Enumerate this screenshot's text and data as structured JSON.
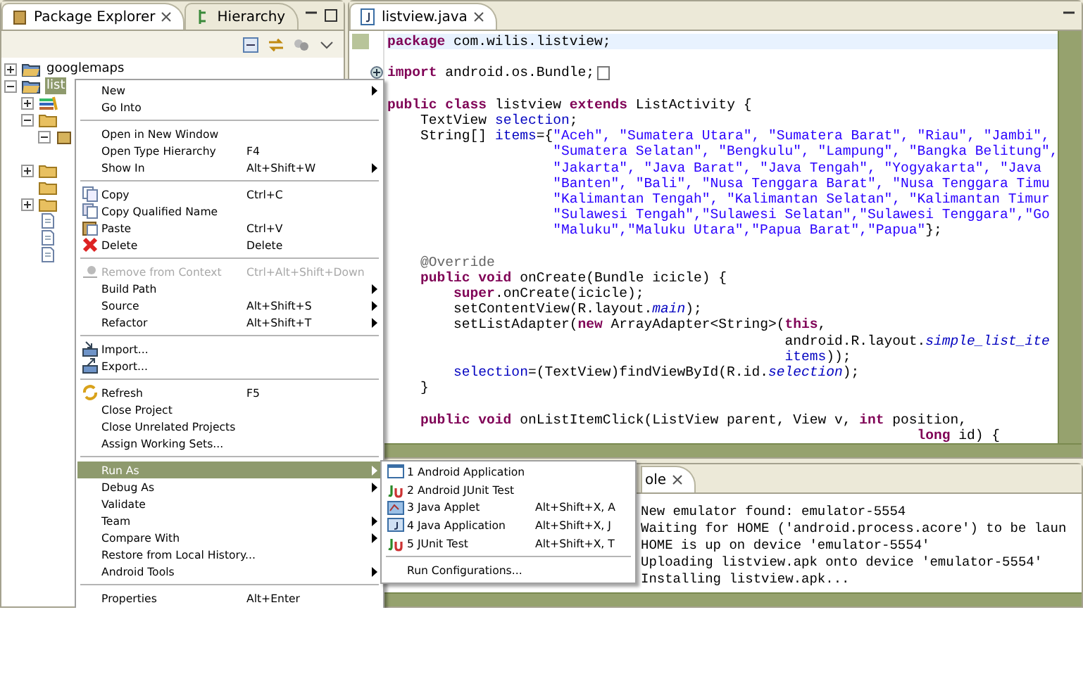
{
  "explorer": {
    "tabs": [
      {
        "label": "Package Explorer",
        "selected": true,
        "closable": true
      },
      {
        "label": "Hierarchy",
        "selected": false,
        "closable": false
      }
    ],
    "tree": [
      {
        "label": "googlemaps",
        "expanded": false,
        "selected": false
      },
      {
        "label": "list",
        "expanded": true,
        "selected": true,
        "children": [
          {
            "kind": "library",
            "expanded": false
          },
          {
            "kind": "folder",
            "expanded": true,
            "children": [
              {
                "kind": "package",
                "expanded": true
              }
            ]
          },
          {
            "kind": "blank"
          },
          {
            "kind": "folder",
            "expanded": false
          },
          {
            "kind": "folder"
          },
          {
            "kind": "folder",
            "expanded": false
          },
          {
            "kind": "file"
          },
          {
            "kind": "file"
          },
          {
            "kind": "file"
          }
        ]
      }
    ]
  },
  "context_menu": [
    {
      "kind": "item",
      "label": "New",
      "submenu": true,
      "selected": false,
      "disabled": false
    },
    {
      "kind": "item",
      "label": "Go Into",
      "selected": false,
      "disabled": false
    },
    {
      "kind": "separator"
    },
    {
      "kind": "item",
      "label": "Open in New Window",
      "selected": false,
      "disabled": false
    },
    {
      "kind": "item",
      "label": "Open Type Hierarchy",
      "shortcut": "F4",
      "selected": false,
      "disabled": false
    },
    {
      "kind": "item",
      "label": "Show In",
      "shortcut": "Alt+Shift+W",
      "submenu": true,
      "selected": false,
      "disabled": false
    },
    {
      "kind": "separator"
    },
    {
      "kind": "item",
      "label": "Copy",
      "shortcut": "Ctrl+C",
      "selected": false,
      "disabled": false
    },
    {
      "kind": "item",
      "label": "Copy Qualified Name",
      "selected": false,
      "disabled": false
    },
    {
      "kind": "item",
      "label": "Paste",
      "shortcut": "Ctrl+V",
      "selected": false,
      "disabled": false
    },
    {
      "kind": "item",
      "label": "Delete",
      "shortcut": "Delete",
      "selected": false,
      "disabled": false
    },
    {
      "kind": "separator"
    },
    {
      "kind": "item",
      "label": "Remove from Context",
      "shortcut": "Ctrl+Alt+Shift+Down",
      "selected": false,
      "disabled": true
    },
    {
      "kind": "item",
      "label": "Build Path",
      "submenu": true,
      "selected": false,
      "disabled": false
    },
    {
      "kind": "item",
      "label": "Source",
      "shortcut": "Alt+Shift+S",
      "submenu": true,
      "selected": false,
      "disabled": false
    },
    {
      "kind": "item",
      "label": "Refactor",
      "shortcut": "Alt+Shift+T",
      "submenu": true,
      "selected": false,
      "disabled": false
    },
    {
      "kind": "separator"
    },
    {
      "kind": "item",
      "label": "Import...",
      "selected": false,
      "disabled": false
    },
    {
      "kind": "item",
      "label": "Export...",
      "selected": false,
      "disabled": false
    },
    {
      "kind": "separator"
    },
    {
      "kind": "item",
      "label": "Refresh",
      "shortcut": "F5",
      "selected": false,
      "disabled": false
    },
    {
      "kind": "item",
      "label": "Close Project",
      "selected": false,
      "disabled": false
    },
    {
      "kind": "item",
      "label": "Close Unrelated Projects",
      "selected": false,
      "disabled": false
    },
    {
      "kind": "item",
      "label": "Assign Working Sets...",
      "selected": false,
      "disabled": false
    },
    {
      "kind": "separator"
    },
    {
      "kind": "item",
      "label": "Run As",
      "submenu": true,
      "selected": true,
      "disabled": false
    },
    {
      "kind": "item",
      "label": "Debug As",
      "submenu": true,
      "selected": false,
      "disabled": false
    },
    {
      "kind": "item",
      "label": "Validate",
      "selected": false,
      "disabled": false
    },
    {
      "kind": "item",
      "label": "Team",
      "submenu": true,
      "selected": false,
      "disabled": false
    },
    {
      "kind": "item",
      "label": "Compare With",
      "submenu": true,
      "selected": false,
      "disabled": false
    },
    {
      "kind": "item",
      "label": "Restore from Local History...",
      "selected": false,
      "disabled": false
    },
    {
      "kind": "item",
      "label": "Android Tools",
      "submenu": true,
      "selected": false,
      "disabled": false
    },
    {
      "kind": "separator"
    },
    {
      "kind": "item",
      "label": "Properties",
      "shortcut": "Alt+Enter",
      "selected": false,
      "disabled": false
    }
  ],
  "run_as_menu": [
    {
      "kind": "item",
      "label": "1 Android Application"
    },
    {
      "kind": "item",
      "label": "2 Android JUnit Test"
    },
    {
      "kind": "item",
      "label": "3 Java Applet",
      "shortcut": "Alt+Shift+X, A"
    },
    {
      "kind": "item",
      "label": "4 Java Application",
      "shortcut": "Alt+Shift+X, J"
    },
    {
      "kind": "item",
      "label": "5 JUnit Test",
      "shortcut": "Alt+Shift+X, T"
    },
    {
      "kind": "separator"
    },
    {
      "kind": "item",
      "label": "Run Configurations..."
    }
  ],
  "editor": {
    "tab": {
      "label": "listview.java",
      "selected": true
    },
    "lines": [
      {
        "current": true,
        "segments": [
          {
            "kind": "keyword",
            "text": "package"
          },
          {
            "kind": "plain",
            "text": " com.wilis.listview;"
          }
        ]
      },
      {
        "current": false
      },
      {
        "current": false,
        "folded": true,
        "segments": [
          {
            "kind": "keyword",
            "text": "import"
          },
          {
            "kind": "plain",
            "text": " android.os.Bundle;"
          }
        ]
      },
      {
        "current": false
      },
      {
        "current": false,
        "segments": [
          {
            "kind": "keyword",
            "text": "public class"
          },
          {
            "kind": "plain",
            "text": " listview "
          },
          {
            "kind": "keyword",
            "text": "extends"
          },
          {
            "kind": "plain",
            "text": " ListActivity {"
          }
        ]
      },
      {
        "current": false,
        "segments": [
          {
            "kind": "plain",
            "text": "    TextView "
          },
          {
            "kind": "field",
            "text": "selection"
          },
          {
            "kind": "plain",
            "text": ";"
          }
        ]
      },
      {
        "current": false,
        "segments": [
          {
            "kind": "plain",
            "text": "    String[] "
          },
          {
            "kind": "field",
            "text": "items"
          },
          {
            "kind": "plain",
            "text": "={"
          },
          {
            "kind": "string",
            "text": "\"Aceh\", \"Sumatera Utara\", \"Sumatera Barat\", \"Riau\", \"Jambi\","
          }
        ]
      },
      {
        "current": false,
        "segments": [
          {
            "kind": "string",
            "text": "                    \"Sumatera Selatan\", \"Bengkulu\", \"Lampung\", \"Bangka Belitung\","
          }
        ]
      },
      {
        "current": false,
        "segments": [
          {
            "kind": "string",
            "text": "                    \"Jakarta\", \"Java Barat\", \"Java Tengah\", \"Yogyakarta\", \"Java"
          }
        ]
      },
      {
        "current": false,
        "segments": [
          {
            "kind": "string",
            "text": "                    \"Banten\", \"Bali\", \"Nusa Tenggara Barat\", \"Nusa Tenggara Timu"
          }
        ]
      },
      {
        "current": false,
        "segments": [
          {
            "kind": "string",
            "text": "                    \"Kalimantan Tengah\", \"Kalimantan Selatan\", \"Kalimantan Timur"
          }
        ]
      },
      {
        "current": false,
        "segments": [
          {
            "kind": "string",
            "text": "                    \"Sulawesi Tengah\",\"Sulawesi Selatan\",\"Sulawesi Tenggara\",\"Go"
          }
        ]
      },
      {
        "current": false,
        "segments": [
          {
            "kind": "string",
            "text": "                    \"Maluku\",\"Maluku Utara\",\"Papua Barat\",\"Papua\""
          },
          {
            "kind": "plain",
            "text": "};"
          }
        ]
      },
      {
        "current": false
      },
      {
        "current": false,
        "segments": [
          {
            "kind": "annotation",
            "text": "    @Override"
          }
        ]
      },
      {
        "current": false,
        "segments": [
          {
            "kind": "keyword",
            "text": "    public void"
          },
          {
            "kind": "plain",
            "text": " onCreate(Bundle icicle) {"
          }
        ]
      },
      {
        "current": false,
        "segments": [
          {
            "kind": "keyword",
            "text": "        super"
          },
          {
            "kind": "plain",
            "text": ".onCreate(icicle);"
          }
        ]
      },
      {
        "current": false,
        "segments": [
          {
            "kind": "plain",
            "text": "        setContentView(R.layout."
          },
          {
            "kind": "static",
            "text": "main"
          },
          {
            "kind": "plain",
            "text": ");"
          }
        ]
      },
      {
        "current": false,
        "segments": [
          {
            "kind": "plain",
            "text": "        setListAdapter("
          },
          {
            "kind": "keyword",
            "text": "new"
          },
          {
            "kind": "plain",
            "text": " ArrayAdapter<String>("
          },
          {
            "kind": "keyword",
            "text": "this"
          },
          {
            "kind": "plain",
            "text": ","
          }
        ]
      },
      {
        "current": false,
        "segments": [
          {
            "kind": "plain",
            "text": "                                                android.R.layout."
          },
          {
            "kind": "static",
            "text": "simple_list_ite"
          }
        ]
      },
      {
        "current": false,
        "segments": [
          {
            "kind": "field",
            "text": "                                                items"
          },
          {
            "kind": "plain",
            "text": "));"
          }
        ]
      },
      {
        "current": false,
        "segments": [
          {
            "kind": "field",
            "text": "        selection"
          },
          {
            "kind": "plain",
            "text": "=(TextView)findViewById(R.id."
          },
          {
            "kind": "static",
            "text": "selection"
          },
          {
            "kind": "plain",
            "text": ");"
          }
        ]
      },
      {
        "current": false,
        "segments": [
          {
            "kind": "plain",
            "text": "    }"
          }
        ]
      },
      {
        "current": false
      },
      {
        "current": false,
        "segments": [
          {
            "kind": "keyword",
            "text": "    public void"
          },
          {
            "kind": "plain",
            "text": " onListItemClick(ListView parent, View v, "
          },
          {
            "kind": "keyword",
            "text": "int"
          },
          {
            "kind": "plain",
            "text": " position,"
          }
        ]
      },
      {
        "current": false,
        "segments": [
          {
            "kind": "keyword",
            "text": "                                                                long"
          },
          {
            "kind": "plain",
            "text": " id) {"
          }
        ]
      }
    ]
  },
  "console": {
    "tab": {
      "label": "ole",
      "selected": true
    },
    "lines": [
      "New emulator found: emulator-5554",
      "Waiting for HOME ('android.process.acore') to be laun",
      "HOME is up on device 'emulator-5554'",
      "Uploading listview.apk onto device 'emulator-5554'",
      "Installing listview.apk..."
    ]
  }
}
